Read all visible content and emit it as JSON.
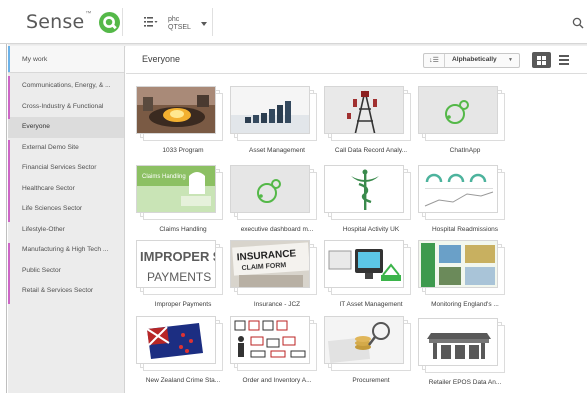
{
  "app": {
    "brand": "Sense",
    "tm": "™",
    "stream_line1": "phc",
    "stream_line2": "QTSEL"
  },
  "sidebar": {
    "items": [
      {
        "label": "My work"
      },
      {
        "label": "Communications, Energy, & ..."
      },
      {
        "label": "Cross-Industry & Functional"
      },
      {
        "label": "Everyone"
      },
      {
        "label": "External Demo Site"
      },
      {
        "label": "Financial Services Sector"
      },
      {
        "label": "Healthcare Sector"
      },
      {
        "label": "Life Sciences Sector"
      },
      {
        "label": "Lifestyle-Other"
      },
      {
        "label": "Manufacturing & High Tech ..."
      },
      {
        "label": "Public Sector"
      },
      {
        "label": "Retail & Services Sector"
      }
    ],
    "active": "Everyone"
  },
  "main": {
    "title": "Everyone",
    "sort_label": "Alphabetically",
    "apps": [
      {
        "label": "1033 Program"
      },
      {
        "label": "Asset Management"
      },
      {
        "label": "Call Data Record Analy..."
      },
      {
        "label": "ChatInApp"
      },
      {
        "label": "Claims Handling"
      },
      {
        "label": "executive dashboard m..."
      },
      {
        "label": "Hospital Activity UK"
      },
      {
        "label": "Hospital Readmissions"
      },
      {
        "label": "Improper Payments"
      },
      {
        "label": "Insurance - JCZ"
      },
      {
        "label": "IT Asset Management"
      },
      {
        "label": "Monitoring England's ..."
      },
      {
        "label": "New Zealand Crime Sta..."
      },
      {
        "label": "Order and Inventory A..."
      },
      {
        "label": "Procurement"
      },
      {
        "label": "Retailer EPOS Data An..."
      }
    ]
  },
  "thumb_text": {
    "claims": "Claims Handling",
    "improper1": "IMPROPER $",
    "improper2": "PAYMENTS",
    "insurance1": "INSURANCE",
    "insurance2": "CLAIM FORM"
  },
  "colors": {
    "brand_green": "#54b848",
    "accent_blue": "#6cb2e8",
    "stripe_pink": "#cc66c6"
  }
}
